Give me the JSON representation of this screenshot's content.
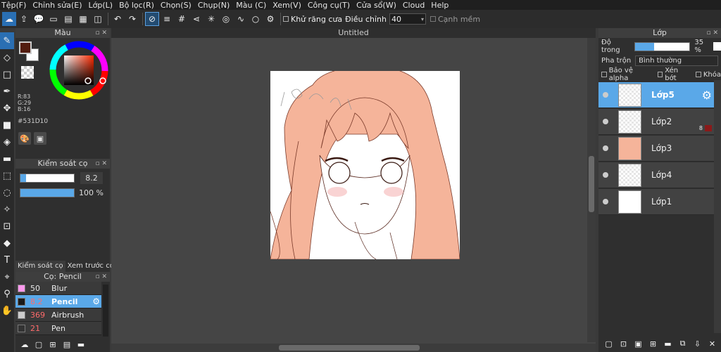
{
  "menu": [
    "Tệp(F)",
    "Chỉnh sửa(E)",
    "Lớp(L)",
    "Bộ lọc(R)",
    "Chọn(S)",
    "Chụp(N)",
    "Màu (C)",
    "Xem(V)",
    "Công cụ(T)",
    "Cửa sổ(W)",
    "Cloud",
    "Help"
  ],
  "toolbar": {
    "antialias_label": "Khử răng cưa",
    "adjust_label": "Điều chỉnh",
    "adjust_value": "40",
    "edge_label": "Cạnh mềm"
  },
  "color_panel": {
    "title": "Màu",
    "r": "R:83",
    "g": "G:29",
    "b": "B:16",
    "hex": "#531D10",
    "fg_color": "#531D10"
  },
  "brush_control": {
    "title": "Kiểm soát cọ",
    "size_value": "8.2",
    "opacity_value": "100 %",
    "size_fraction": 0.1,
    "opacity_fraction": 1.0,
    "tab_control": "Kiểm soát cọ",
    "tab_preview": "Xem trước cọ"
  },
  "brush_list": {
    "title": "Cọ: Pencil",
    "items": [
      {
        "size": "50",
        "name": "Blur",
        "color": "#ff99ee",
        "size_color": "#e6e6e6"
      },
      {
        "size": "8.2",
        "name": "Pencil",
        "color": "#1a1a1a",
        "size_color": "#ff6b6b"
      },
      {
        "size": "369",
        "name": "Airbrush",
        "color": "#cccccc",
        "size_color": "#ff6b6b"
      },
      {
        "size": "21",
        "name": "Pen",
        "color": "#333333",
        "size_color": "#ff6b6b"
      }
    ]
  },
  "canvas": {
    "title": "Untitled"
  },
  "layer_panel": {
    "title": "Lớp",
    "opacity_label": "Độ trong",
    "opacity_value": "35 %",
    "opacity_fraction": 0.35,
    "blend_label": "Pha trộn",
    "blend_value": "Bình thường",
    "protect_alpha": "Bảo vệ alpha",
    "clipping": "Xén bớt",
    "lock": "Khóa",
    "layers": [
      {
        "name": "Lớp5",
        "selected": true,
        "thumb": "trans"
      },
      {
        "name": "Lớp2",
        "selected": false,
        "thumb": "trans",
        "badge": "8"
      },
      {
        "name": "Lớp3",
        "selected": false,
        "thumb": "peach"
      },
      {
        "name": "Lớp4",
        "selected": false,
        "thumb": "trans"
      },
      {
        "name": "Lớp1",
        "selected": false,
        "thumb": "white"
      }
    ]
  }
}
